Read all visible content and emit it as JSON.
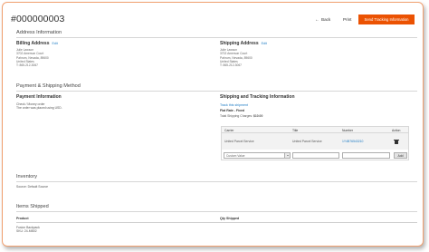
{
  "header": {
    "order_number": "#000000003",
    "back_label": "Back",
    "print_label": "Print",
    "send_tracking_label": "Send Tracking Information"
  },
  "address_info": {
    "title": "Address Information",
    "billing": {
      "title": "Billing Address",
      "edit_label": "Edit",
      "lines": [
        "Julie Lawson",
        "3702 Amerson Court",
        "Pahrum, Nevada, 89600",
        "United States",
        "T: 865-212-3067"
      ]
    },
    "shipping": {
      "title": "Shipping Address",
      "edit_label": "Edit",
      "lines": [
        "Julie Lawson",
        "3702 Amerson Court",
        "Pahrum, Nevada, 89600",
        "United States",
        "T: 865-212-3067"
      ]
    }
  },
  "payment_shipping": {
    "title": "Payment & Shipping Method",
    "payment": {
      "title": "Payment Information",
      "lines": [
        "Check / Money order",
        "The order was placed using USD."
      ]
    },
    "shipping": {
      "title": "Shipping and Tracking Information",
      "track_link": "Track this shipment",
      "method": "Flat Rate - Fixed",
      "charges_label": "Total Shipping Charges:",
      "charges_value": "$10.00"
    }
  },
  "tracking_table": {
    "headers": [
      "Carrier",
      "Title",
      "Number",
      "Action"
    ],
    "row": {
      "carrier": "United Parcel Service",
      "title": "United Parcel Service",
      "number": "1Y4B76543210"
    },
    "carrier_select_value": "Custom Value",
    "add_label": "Add"
  },
  "inventory": {
    "title": "Inventory",
    "source_label": "Source: Default Source"
  },
  "items_shipped": {
    "title": "Items Shipped",
    "headers": [
      "Product",
      "Qty Shipped"
    ],
    "product_name": "Fusion Backpack",
    "product_sku": "SKU: 24-MB02"
  }
}
